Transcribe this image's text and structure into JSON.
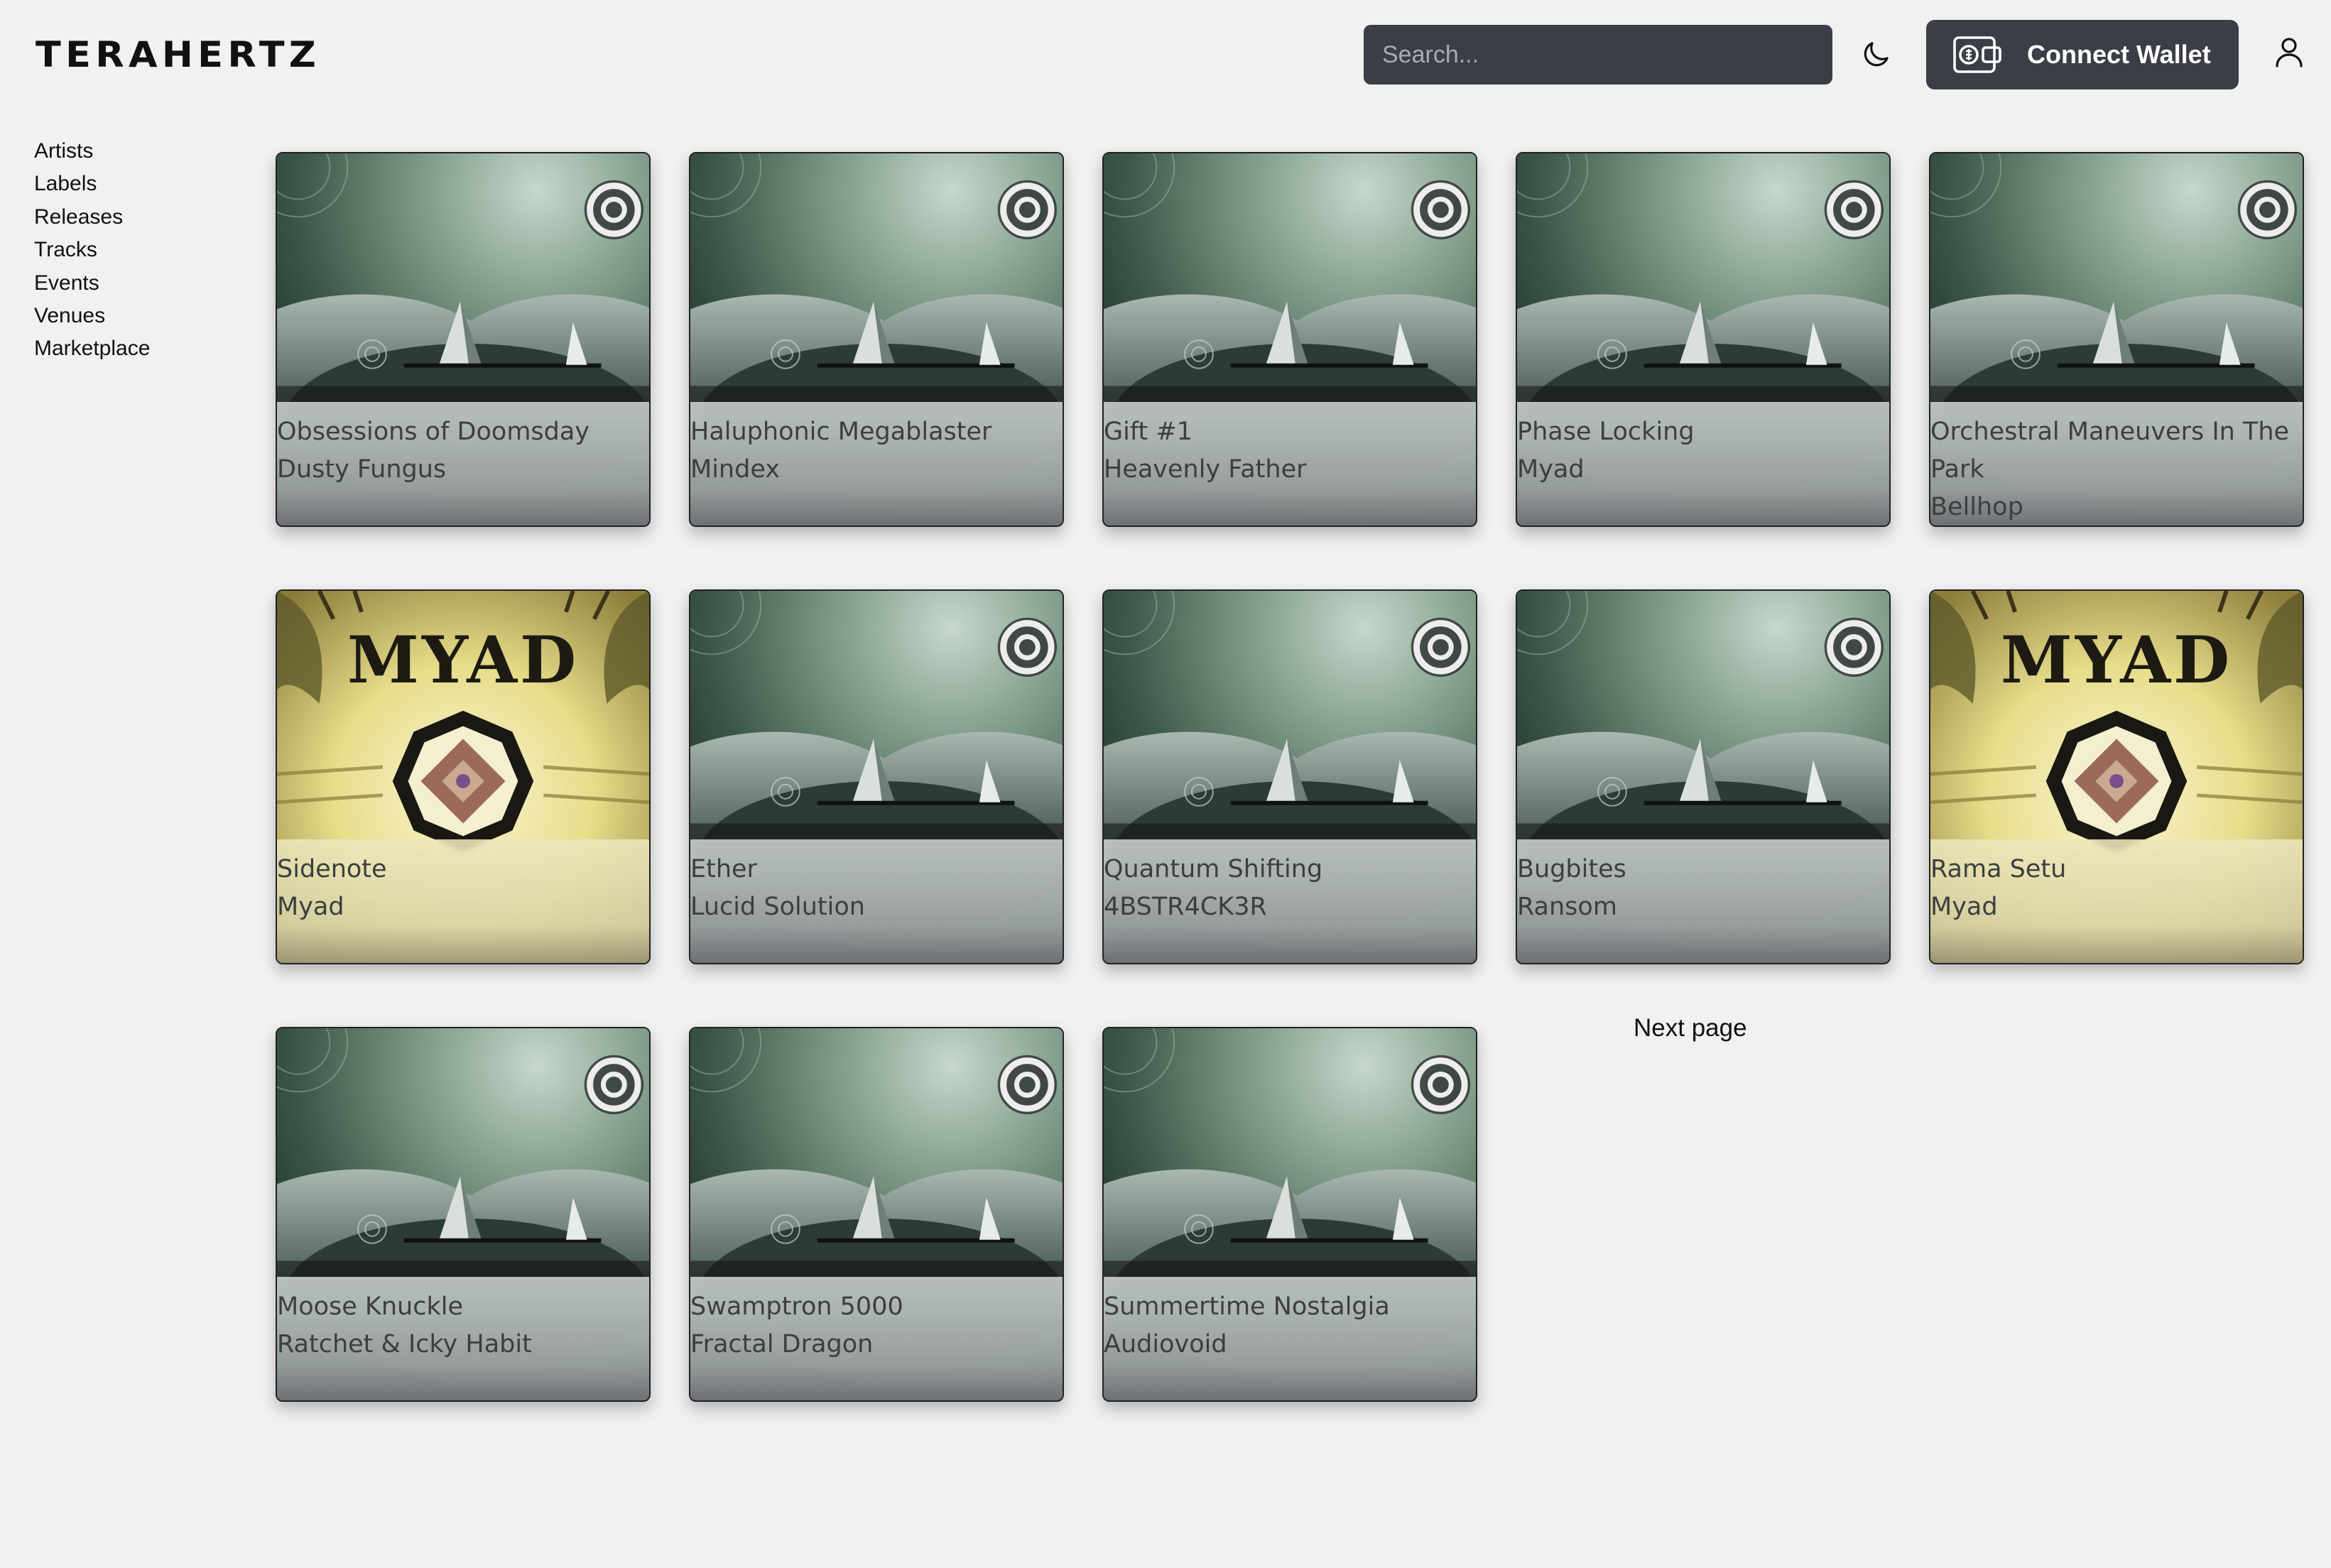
{
  "header": {
    "logo": "TERAHERTZ",
    "search_placeholder": "Search...",
    "theme_icon": "moon-icon",
    "wallet_label": "Connect Wallet",
    "wallet_icon": "wallet-icon",
    "user_icon": "user-icon"
  },
  "sidebar": {
    "items": [
      {
        "label": "Artists"
      },
      {
        "label": "Labels"
      },
      {
        "label": "Releases"
      },
      {
        "label": "Tracks"
      },
      {
        "label": "Events"
      },
      {
        "label": "Venues"
      },
      {
        "label": "Marketplace"
      }
    ]
  },
  "releases": [
    {
      "title": "Obsessions of Doomsday",
      "artist": "Dusty Fungus",
      "artwork": "green-landscape"
    },
    {
      "title": "Haluphonic Megablaster",
      "artist": "Mindex",
      "artwork": "green-landscape"
    },
    {
      "title": "Gift #1",
      "artist": "Heavenly Father",
      "artwork": "green-landscape"
    },
    {
      "title": "Phase Locking",
      "artist": "Myad",
      "artwork": "green-landscape"
    },
    {
      "title": "Orchestral Maneuvers In The Park",
      "artist": "Bellhop",
      "artwork": "green-landscape"
    },
    {
      "title": "Sidenote",
      "artist": "Myad",
      "artwork": "myad-mandala"
    },
    {
      "title": "Ether",
      "artist": "Lucid Solution",
      "artwork": "green-landscape"
    },
    {
      "title": "Quantum Shifting",
      "artist": "4BSTR4CK3R",
      "artwork": "green-landscape"
    },
    {
      "title": "Bugbites",
      "artist": "Ransom",
      "artwork": "green-landscape"
    },
    {
      "title": "Rama Setu",
      "artist": "Myad",
      "artwork": "myad-mandala"
    },
    {
      "title": "Moose Knuckle",
      "artist": "Ratchet & Icky Habit",
      "artwork": "green-landscape"
    },
    {
      "title": "Swamptron 5000",
      "artist": "Fractal Dragon",
      "artwork": "green-landscape"
    },
    {
      "title": "Summertime Nostalgia",
      "artist": "Audiovoid",
      "artwork": "green-landscape"
    }
  ],
  "artwork_text": {
    "myad": "MYAD"
  },
  "pagination": {
    "next_label": "Next page"
  },
  "colors": {
    "background": "#f1f1f1",
    "dark_control": "#3b3e47",
    "text": "#111111"
  }
}
